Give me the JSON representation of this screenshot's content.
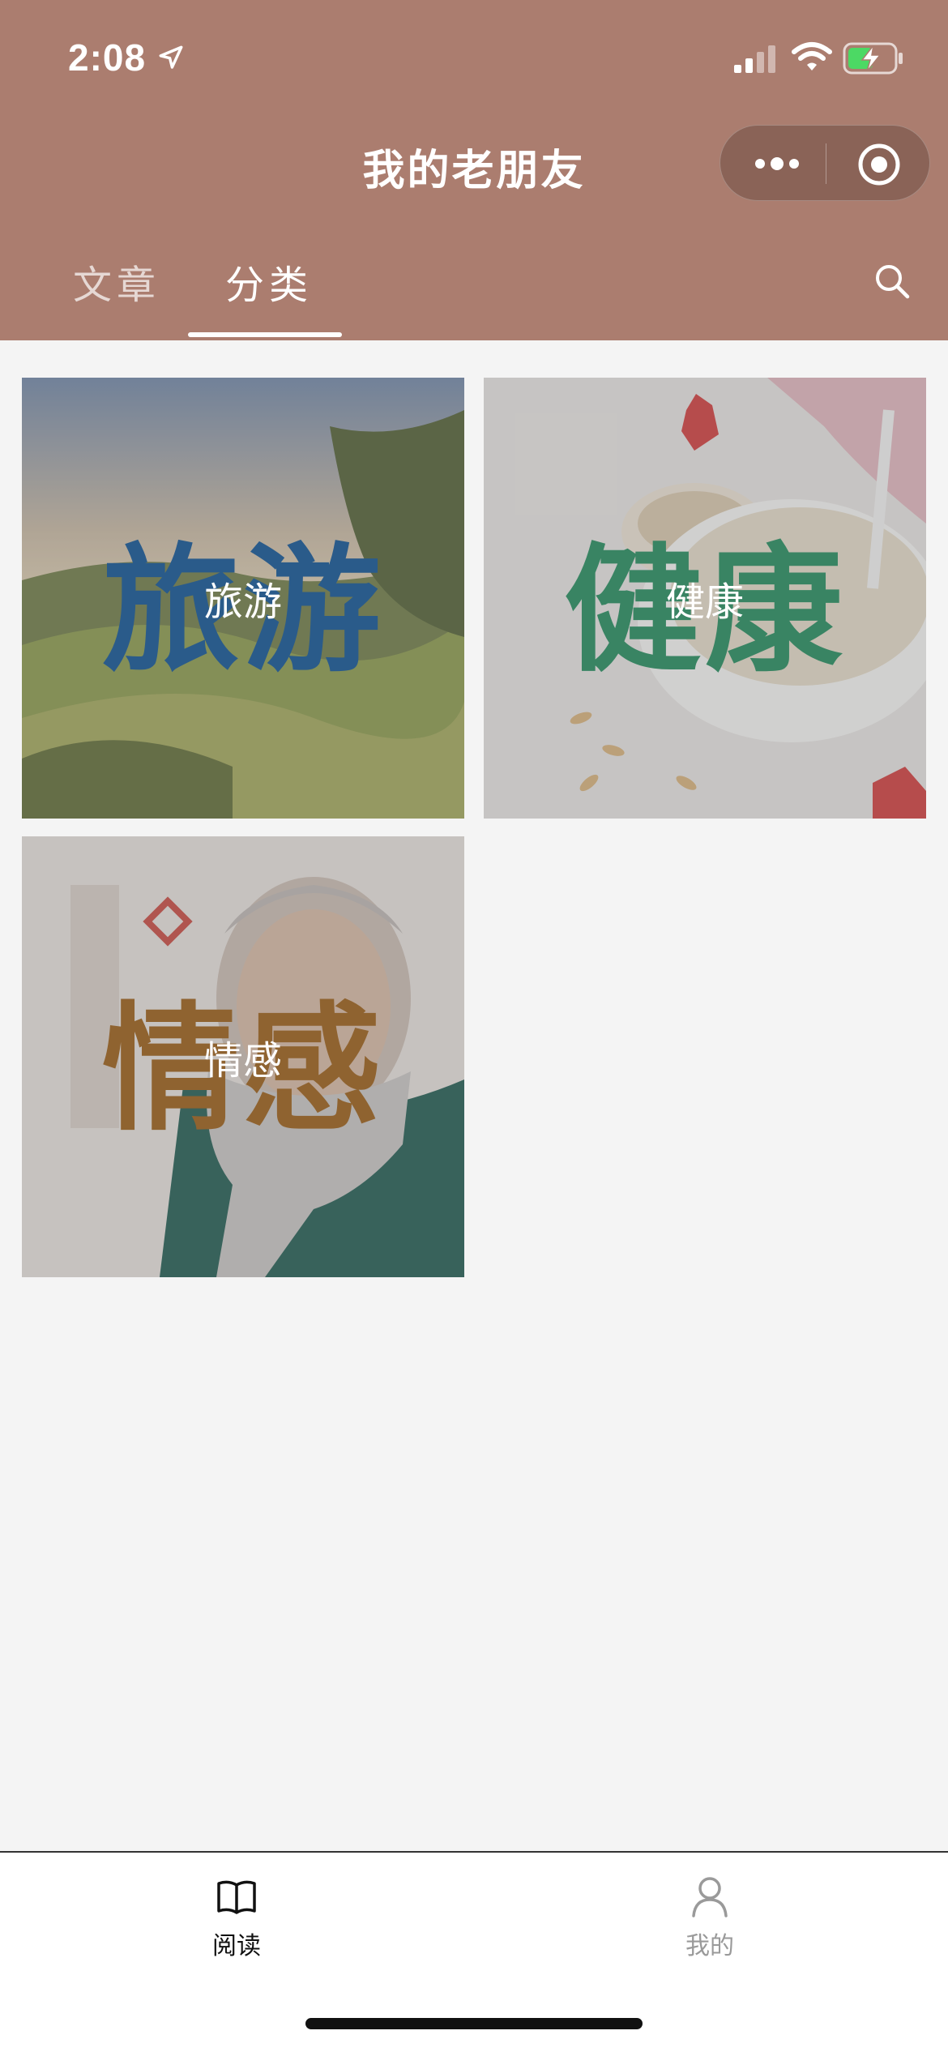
{
  "status_bar": {
    "time": "2:08",
    "icons": [
      "location-arrow-icon",
      "signal-icon",
      "wifi-icon",
      "battery-charging-icon"
    ]
  },
  "header": {
    "title": "我的老朋友",
    "capsule_icons": [
      "more-dots-icon",
      "close-target-icon"
    ],
    "bg_color": "#ab7d6f"
  },
  "tabs": [
    {
      "label": "文章",
      "active": false
    },
    {
      "label": "分类",
      "active": true
    }
  ],
  "categories": [
    {
      "label": "旅游",
      "watermark": "旅游",
      "accent": "#0a4f93"
    },
    {
      "label": "健康",
      "watermark": "健康",
      "accent": "#1f8a5b"
    },
    {
      "label": "情感",
      "watermark": "情感",
      "accent": "#9a5b12"
    }
  ],
  "tabbar": {
    "items": [
      {
        "label": "阅读",
        "icon": "book-open-icon",
        "active": true
      },
      {
        "label": "我的",
        "icon": "person-icon",
        "active": false
      }
    ]
  }
}
